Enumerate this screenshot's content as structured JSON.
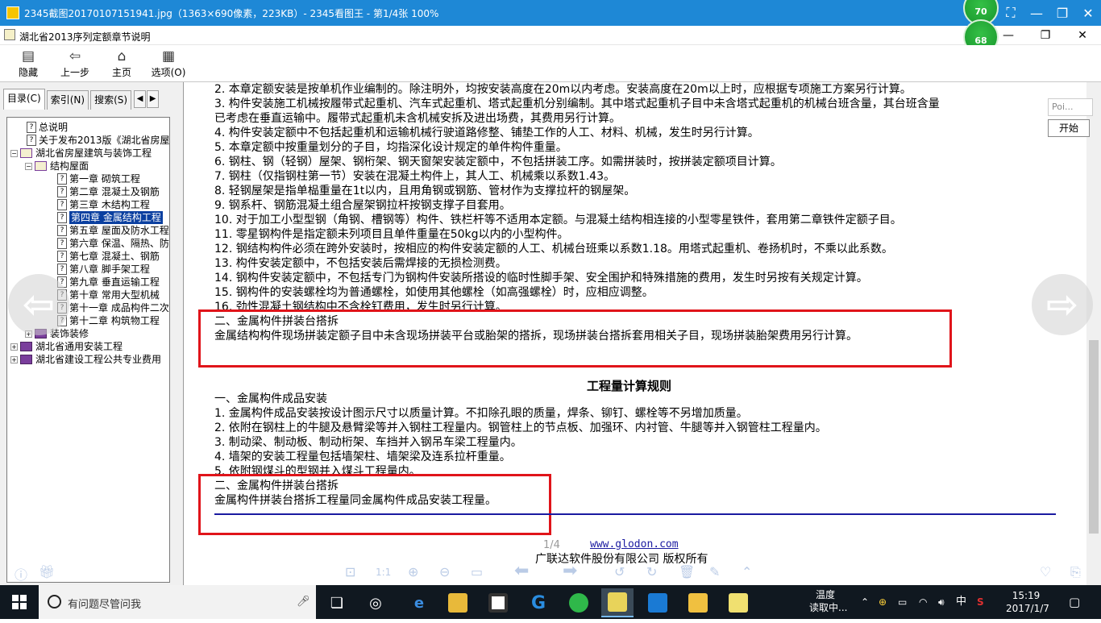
{
  "viewer": {
    "title": "2345截图20170107151941.jpg（1363×690像素，223KB）- 2345看图王 - 第1/4张 100%",
    "badge_top": "70",
    "badge_bottom": "68"
  },
  "help_window": {
    "title": "湖北省2013序列定额章节说明",
    "toolbar": [
      {
        "label": "隐藏",
        "icon": "hide-icon"
      },
      {
        "label": "上一步",
        "icon": "back-arrow-icon"
      },
      {
        "label": "主页",
        "icon": "home-icon"
      },
      {
        "label": "选项(O)",
        "icon": "options-icon"
      }
    ]
  },
  "nav": {
    "tabs": [
      "目录(C)",
      "索引(N)",
      "搜索(S)"
    ],
    "tree": [
      {
        "label": "总说明",
        "level": 2,
        "kind": "page"
      },
      {
        "label": "关于发布2013版《湖北省房屋",
        "level": 2,
        "kind": "page"
      },
      {
        "label": "湖北省房屋建筑与装饰工程",
        "level": 1,
        "kind": "book-open",
        "exp": "−"
      },
      {
        "label": "结构屋面",
        "level": 2,
        "kind": "book-open",
        "exp": "−"
      },
      {
        "label": "第一章 砌筑工程",
        "level": 3,
        "kind": "page"
      },
      {
        "label": "第二章 混凝土及钢筋",
        "level": 3,
        "kind": "page"
      },
      {
        "label": "第三章 木结构工程",
        "level": 3,
        "kind": "page"
      },
      {
        "label": "第四章 金属结构工程",
        "level": 3,
        "kind": "page",
        "selected": true
      },
      {
        "label": "第五章 屋面及防水工程",
        "level": 3,
        "kind": "page"
      },
      {
        "label": "第六章 保温、隔热、防",
        "level": 3,
        "kind": "page"
      },
      {
        "label": "第七章 混凝土、钢筋",
        "level": 3,
        "kind": "page"
      },
      {
        "label": "第八章 脚手架工程",
        "level": 3,
        "kind": "page"
      },
      {
        "label": "第九章 垂直运输工程",
        "level": 3,
        "kind": "page"
      },
      {
        "label": "第十章 常用大型机械",
        "level": 3,
        "kind": "page"
      },
      {
        "label": "第十一章 成品构件二次",
        "level": 3,
        "kind": "page"
      },
      {
        "label": "第十二章 构筑物工程",
        "level": 3,
        "kind": "page"
      },
      {
        "label": "装饰装修",
        "level": 2,
        "kind": "book",
        "exp": "+"
      },
      {
        "label": "湖北省通用安装工程",
        "level": 1,
        "kind": "book",
        "exp": "+"
      },
      {
        "label": "湖北省建设工程公共专业费用",
        "level": 1,
        "kind": "book",
        "exp": "+"
      }
    ]
  },
  "content": {
    "lines_top": [
      "2. 本章定额安装是按单机作业编制的。除注明外，均按安装高度在20m以内考虑。安装高度在20m以上时，应根据专项施工方案另行计算。",
      "3. 构件安装施工机械按履带式起重机、汽车式起重机、塔式起重机分别编制。其中塔式起重机子目中未含塔式起重机的机械台班含量，其台班含量",
      "已考虑在垂直运输中。履带式起重机未含机械安拆及进出场费，其费用另行计算。",
      "4. 构件安装定额中不包括起重机和运输机械行驶道路修整、铺垫工作的人工、材料、机械，发生时另行计算。",
      "5. 本章定额中按重量划分的子目，均指深化设计规定的单件构件重量。",
      "6. 钢柱、钢（轻钢）屋架、钢桁架、钢天窗架安装定额中，不包括拼装工序。如需拼装时，按拼装定额项目计算。",
      "7. 钢柱（仅指钢柱第一节）安装在混凝土构件上，其人工、机械乘以系数1.43。",
      "8. 轻钢屋架是指单榀重量在1t以内，且用角钢或钢筋、管材作为支撑拉杆的钢屋架。",
      "9. 钢系杆、钢筋混凝土组合屋架钢拉杆按钢支撑子目套用。",
      "10. 对于加工小型型钢（角钢、槽钢等）构件、铁栏杆等不适用本定额。与混凝土结构相连接的小型零星铁件，套用第二章铁件定额子目。",
      "11. 零星钢构件是指定额未列项目且单件重量在50kg以内的小型构件。",
      "12. 钢结构构件必须在跨外安装时，按相应的构件安装定额的人工、机械台班乘以系数1.18。用塔式起重机、卷扬机时，不乘以此系数。",
      "13. 构件安装定额中，不包括安装后需焊接的无损检测费。",
      "14. 钢构件安装定额中，不包括专门为钢构件安装所搭设的临时性脚手架、安全围护和特殊措施的费用，发生时另按有关规定计算。",
      "15. 钢构件的安装螺栓均为普通螺栓，如使用其他螺栓（如高强螺栓）时，应相应调整。",
      "16. 劲性混凝土钢结构中不含栓钉费用，发生时另行计算。"
    ],
    "section2_title": "二、金属构件拼装台搭拆",
    "section2_text": "金属结构构件现场拼装定额子目中未含现场拼装平台或胎架的搭拆，现场拼装台搭拆套用相关子目，现场拼装胎架费用另行计算。",
    "rules_heading": "工程量计算规则",
    "rules_lines": [
      "一、金属构件成品安装",
      "1. 金属构件成品安装按设计图示尺寸以质量计算。不扣除孔眼的质量，焊条、铆钉、螺栓等不另增加质量。",
      "2. 依附在钢柱上的牛腿及悬臂梁等并入钢柱工程量内。钢管柱上的节点板、加强环、内衬管、牛腿等并入钢管柱工程量内。",
      "3. 制动梁、制动板、制动桁架、车挡并入钢吊车梁工程量内。",
      "4. 墙架的安装工程量包括墙架柱、墙架梁及连系拉杆重量。",
      "5. 依附钢煤斗的型钢并入煤斗工程量内。"
    ],
    "rules_section2_title": "二、金属构件拼装台搭拆",
    "rules_section2_text": "金属构件拼装台搭拆工程量同金属构件成品安装工程量。",
    "footer_link": "www.glodon.com",
    "footer_copy": "广联达软件股份有限公司 版权所有",
    "page_indicator": "1/4"
  },
  "float_widget": {
    "poi_placeholder": "Poi...",
    "start_label": "开始"
  },
  "taskbar": {
    "search_placeholder": "有问题尽管问我",
    "temp_label": "温度",
    "temp_status": "读取中...",
    "ime": "中",
    "time": "15:19",
    "date": "2017/1/7"
  },
  "colors": {
    "viewer_title_bg": "#1e88d6",
    "highlight_box": "#e0141a",
    "selection": "#0a3fa0",
    "taskbar_bg": "#101820"
  }
}
